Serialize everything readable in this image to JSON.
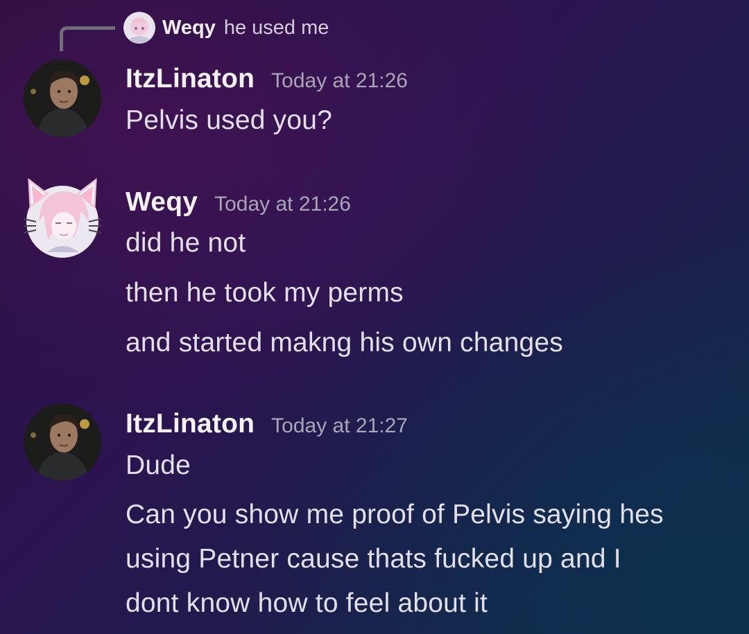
{
  "reply": {
    "author": "Weqy",
    "text": "he used me"
  },
  "messages": [
    {
      "author": "ItzLinaton",
      "timestamp": "Today at 21:26",
      "lines": [
        "Pelvis used you?"
      ]
    },
    {
      "author": "Weqy",
      "timestamp": "Today at 21:26",
      "lines": [
        "did he not",
        "then he took my perms",
        "and started makng his own changes"
      ]
    },
    {
      "author": "ItzLinaton",
      "timestamp": "Today at 21:27",
      "lines": [
        "Dude",
        "Can you show me proof of Pelvis saying hes",
        "using Petner cause thats fucked up and I",
        "dont know how to feel about it"
      ]
    }
  ],
  "colors": {
    "background_start": "#2a0f3e",
    "background_end": "#0f2e4a",
    "username": "#f4f2f8",
    "timestamp": "#a9a6b6",
    "message_text": "#e3e0ea",
    "reply_spine": "#6f6d78"
  }
}
